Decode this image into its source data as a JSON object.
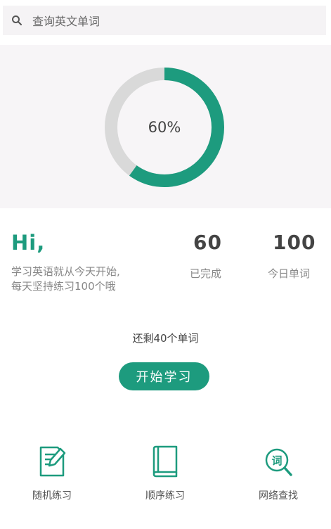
{
  "search": {
    "placeholder": "查询英文单词",
    "icon": "search-icon"
  },
  "progress": {
    "percent_label": "60%",
    "fraction": 0.6,
    "track_color": "#d9d9d9",
    "fill_color": "#1d9b7e"
  },
  "greeting": {
    "hi": "Hi,",
    "line1": "学习英语就从今天开始,",
    "line2": "每天坚持练习100个哦"
  },
  "stats": [
    {
      "value": "60",
      "label": "已完成"
    },
    {
      "value": "100",
      "label": "今日单词"
    }
  ],
  "remaining": "还剩40个单词",
  "start_button": "开始学习",
  "bottom_nav": [
    {
      "label": "随机练习",
      "icon": "note-edit-icon"
    },
    {
      "label": "顺序练习",
      "icon": "book-icon"
    },
    {
      "label": "网络查找",
      "icon": "word-search-icon"
    }
  ],
  "accent": "#1d9b7e"
}
